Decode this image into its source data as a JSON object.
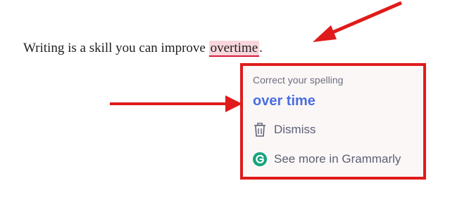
{
  "editor": {
    "text_before": "Writing is a skill you can improve ",
    "misspelled_word": "overtime",
    "text_after": "."
  },
  "popup": {
    "header": "Correct your spelling",
    "suggestion": "over time",
    "dismiss_label": "Dismiss",
    "more_label": "See more in Grammarly"
  },
  "icons": {
    "dismiss": "trash-icon",
    "more": "grammarly-logo-icon"
  },
  "colors": {
    "accent": "#4a6ee0",
    "error_underline": "#d81b3b",
    "error_highlight": "#f8d7dc",
    "annotation": "#e01b1b",
    "grammarly_green": "#15a37e"
  }
}
